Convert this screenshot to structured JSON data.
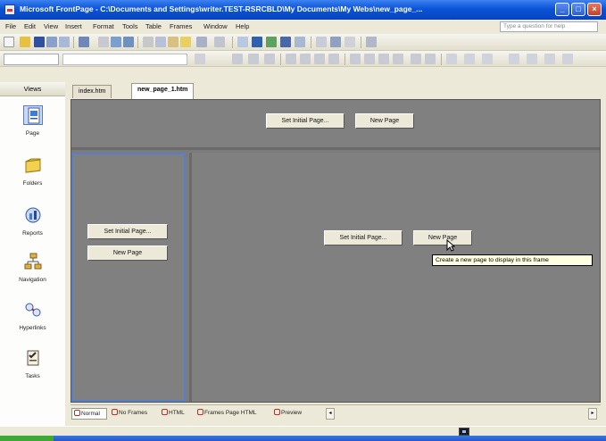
{
  "window": {
    "title": "Microsoft FrontPage - C:\\Documents and Settings\\writer.TEST-RSRCBLD\\My Documents\\My Webs\\new_page_...",
    "controls": [
      "_",
      "□",
      "×"
    ]
  },
  "menubar": {
    "items": [
      "File",
      "Edit",
      "View",
      "Insert",
      "Format",
      "Tools",
      "Table",
      "Frames",
      "Window",
      "Help"
    ],
    "help_placeholder": "Type a question for help"
  },
  "views_panel": {
    "header": "Views",
    "items": [
      {
        "label": "Page",
        "icon": "page-view-icon",
        "selected": true
      },
      {
        "label": "Folders",
        "icon": "folders-view-icon",
        "selected": false
      },
      {
        "label": "Reports",
        "icon": "reports-view-icon",
        "selected": false
      },
      {
        "label": "Navigation",
        "icon": "navigation-view-icon",
        "selected": false
      },
      {
        "label": "Hyperlinks",
        "icon": "hyperlinks-view-icon",
        "selected": false
      },
      {
        "label": "Tasks",
        "icon": "tasks-view-icon",
        "selected": false
      }
    ]
  },
  "doc_tabs": [
    {
      "label": "index.htm",
      "active": false
    },
    {
      "label": "new_page_1.htm",
      "active": true
    }
  ],
  "frames": {
    "top": {
      "set_initial": "Set Initial Page...",
      "new_page": "New Page"
    },
    "left": {
      "set_initial": "Set Initial Page...",
      "new_page": "New Page"
    },
    "main": {
      "set_initial": "Set Initial Page...",
      "new_page": "New Page"
    }
  },
  "tooltip": "Create a new page to display in this frame",
  "view_tabs": [
    {
      "label": "Normal",
      "active": true
    },
    {
      "label": "No Frames",
      "active": false
    },
    {
      "label": "HTML",
      "active": false
    },
    {
      "label": "Frames Page HTML",
      "active": false
    },
    {
      "label": "Preview",
      "active": false
    }
  ],
  "colors": {
    "titlebar": "#0a54d8",
    "frame_bg": "#808080",
    "frame_selected_border": "#5a7fc8",
    "chrome": "#ece9d8"
  }
}
